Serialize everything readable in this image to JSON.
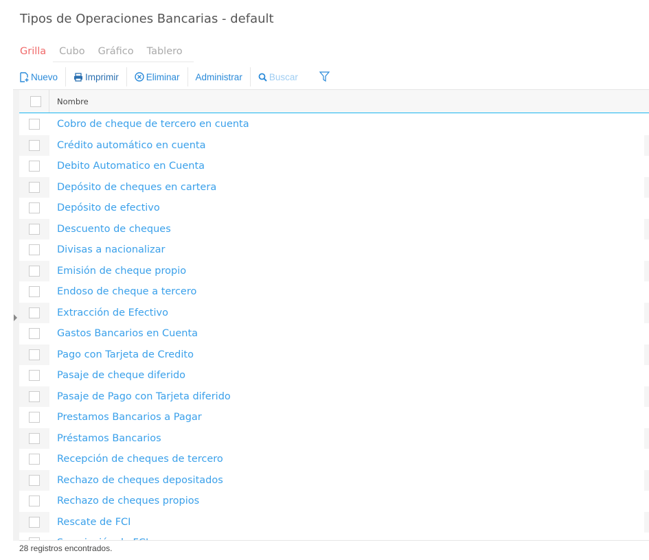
{
  "title": "Tipos de Operaciones Bancarias - default",
  "tabs": [
    "Grilla",
    "Cubo",
    "Gráfico",
    "Tablero"
  ],
  "toolbar": {
    "new": "Nuevo",
    "print": "Imprimir",
    "delete": "Eliminar",
    "manage": "Administrar",
    "search": "Buscar"
  },
  "grid": {
    "column": "Nombre",
    "rows": [
      "Cobro de cheque de tercero en cuenta",
      "Crédito automático en cuenta",
      "Debito Automatico en Cuenta",
      "Depósito de cheques en cartera",
      "Depósito de efectivo",
      "Descuento de cheques",
      "Divisas a nacionalizar",
      "Emisión de cheque propio",
      "Endoso de cheque a tercero",
      "Extracción de Efectivo",
      "Gastos Bancarios en Cuenta",
      "Pago con Tarjeta de Credito",
      "Pasaje de cheque diferido",
      "Pasaje de Pago con Tarjeta diferido",
      "Prestamos Bancarios a Pagar",
      "Préstamos Bancarios",
      "Recepción de cheques de tercero",
      "Rechazo de cheques depositados",
      "Rechazo de cheques propios",
      "Rescate de FCI",
      "Suscripción de FCI"
    ]
  },
  "footer": "28 registros encontrados."
}
